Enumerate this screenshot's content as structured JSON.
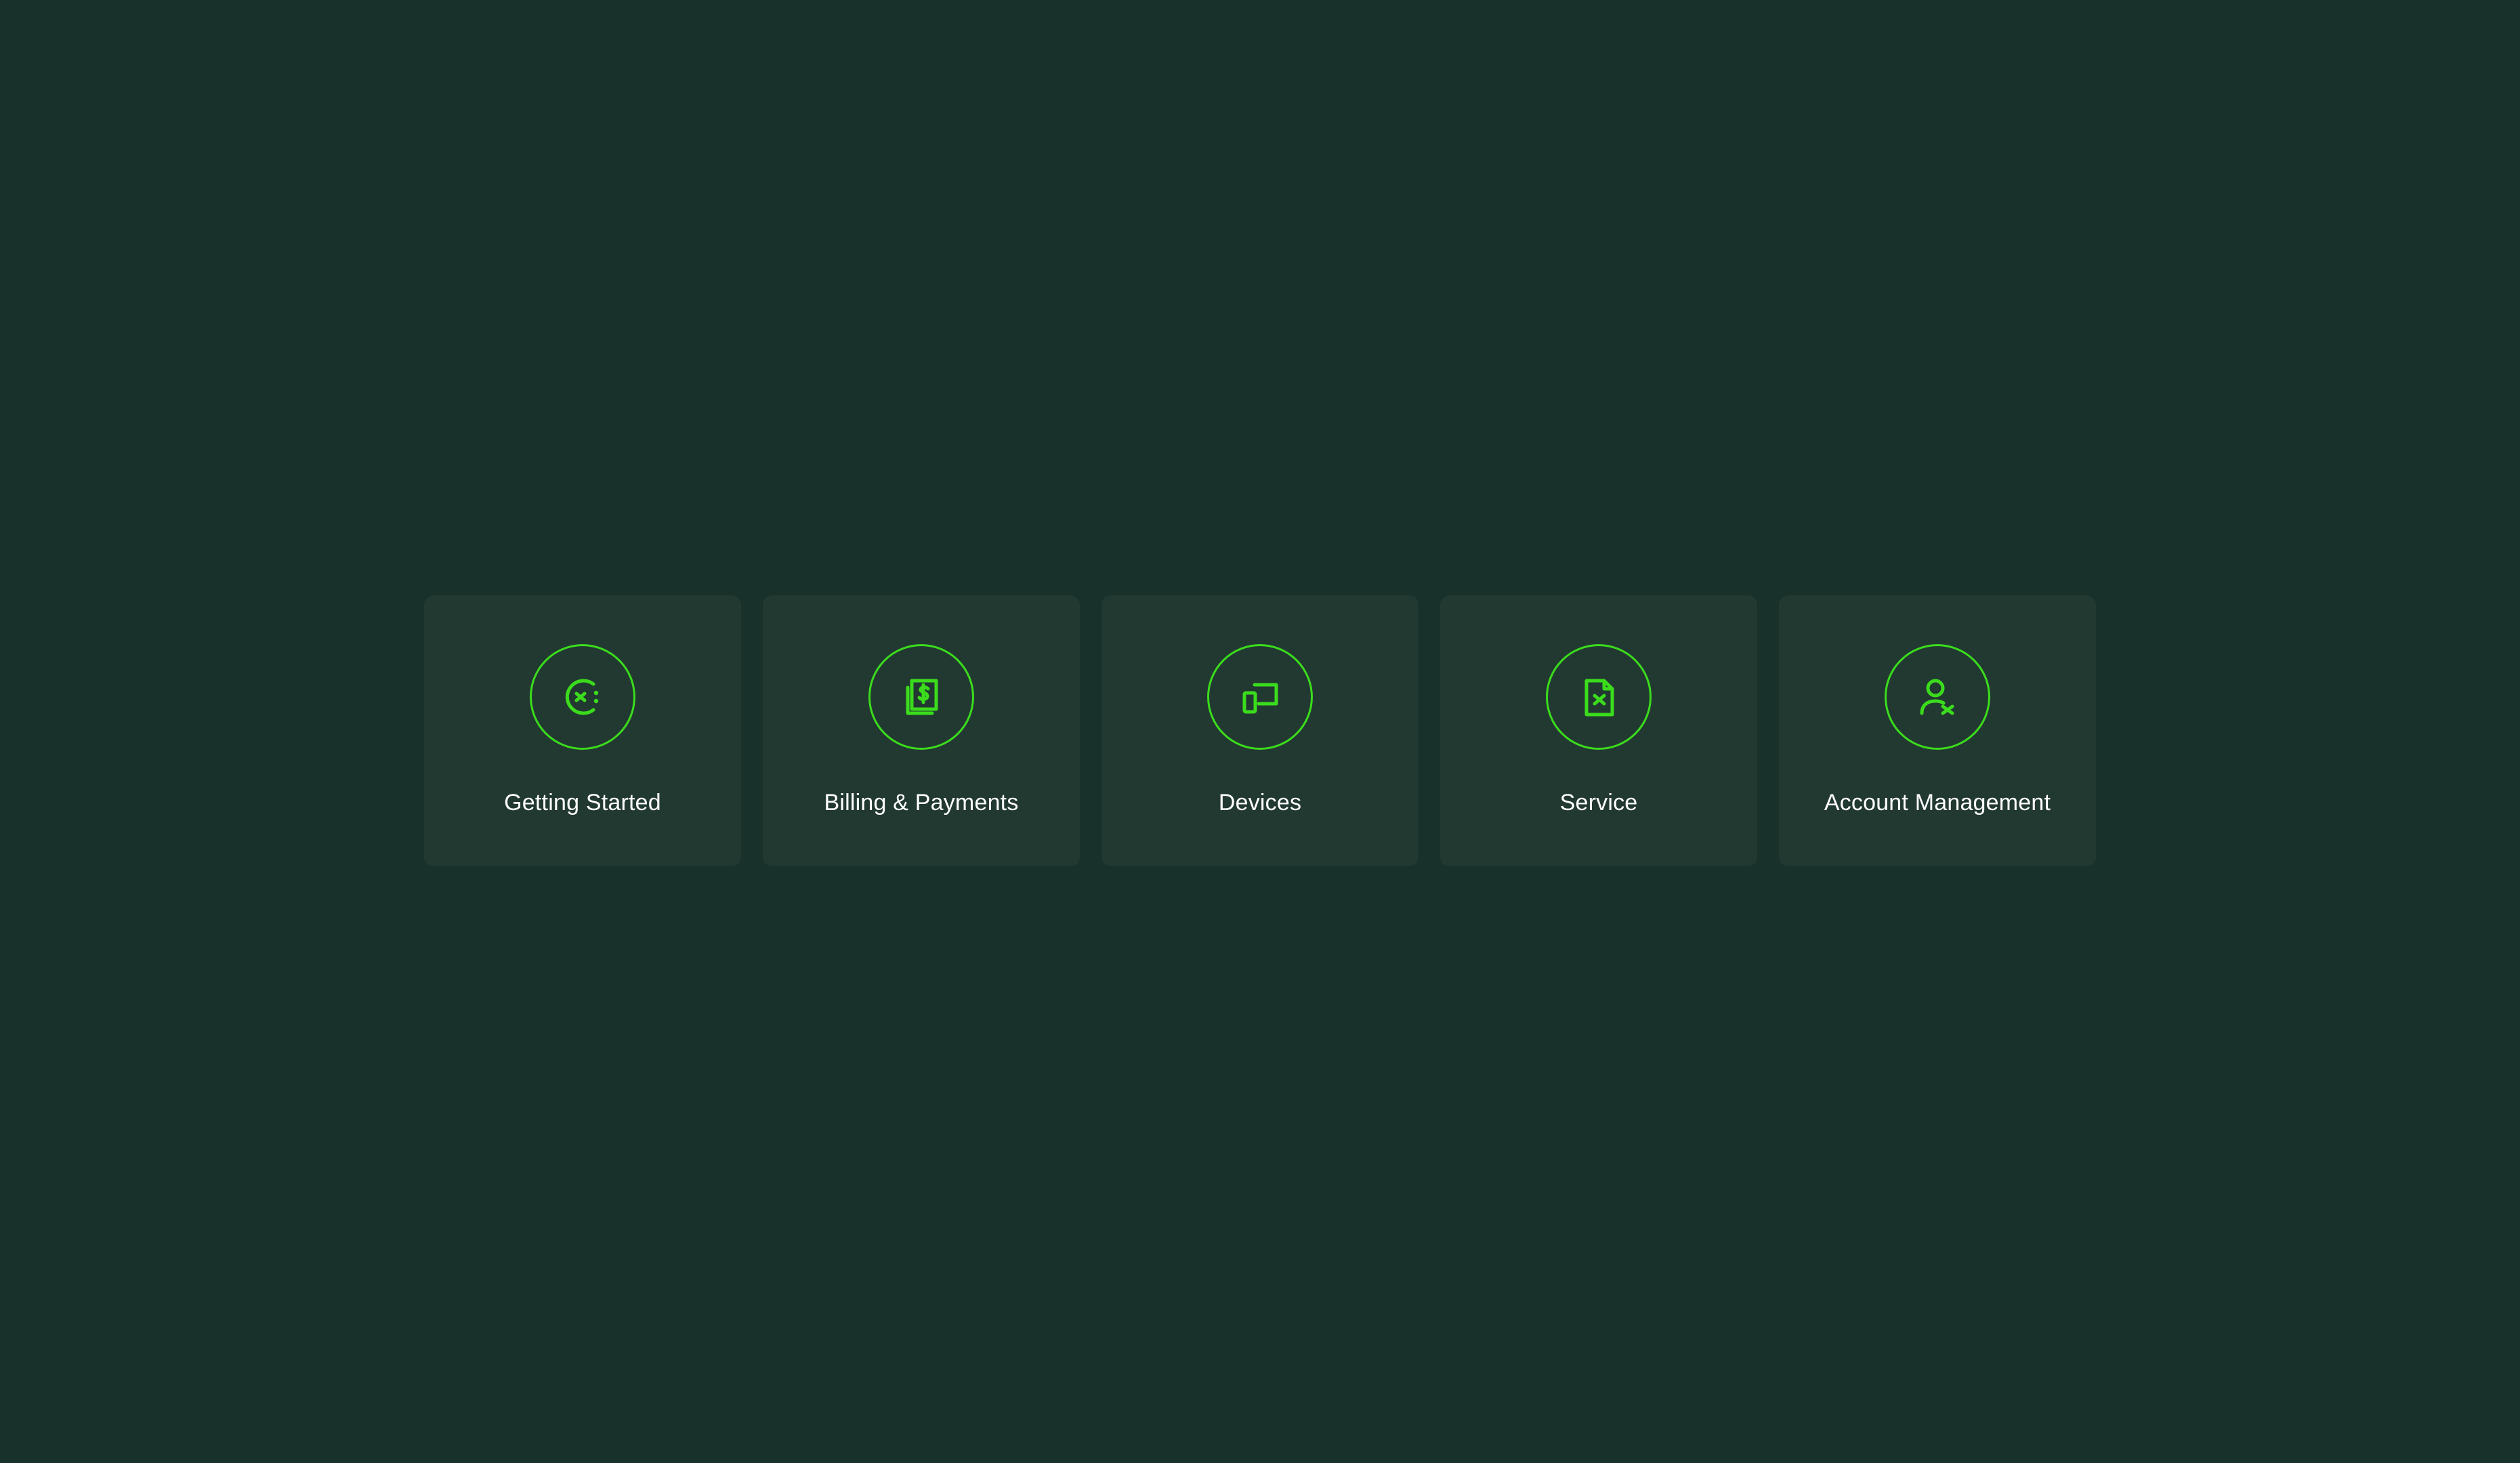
{
  "theme": {
    "background": "#18312a",
    "tile_background": "#223932",
    "accent": "#3bdc1c",
    "label_color": "#ffffff"
  },
  "tiles": [
    {
      "label": "Getting Started",
      "icon": "getting-started-icon"
    },
    {
      "label": "Billing & Payments",
      "icon": "billing-payments-icon"
    },
    {
      "label": "Devices",
      "icon": "devices-icon"
    },
    {
      "label": "Service",
      "icon": "service-document-icon"
    },
    {
      "label": "Account Management",
      "icon": "account-user-icon"
    }
  ]
}
